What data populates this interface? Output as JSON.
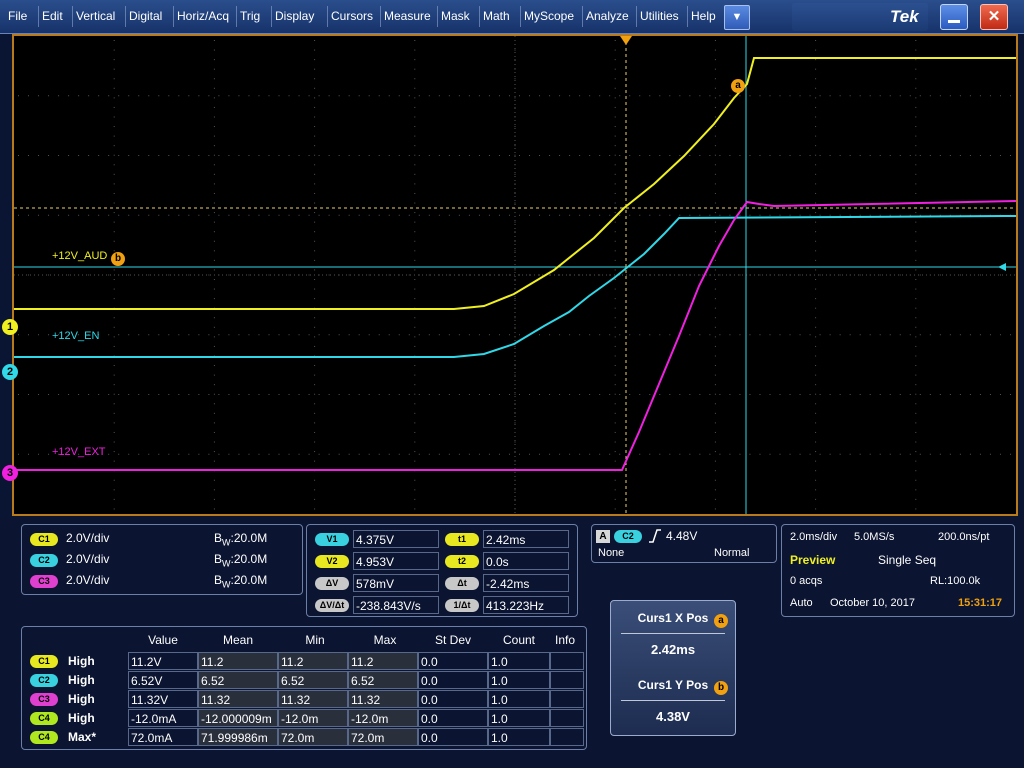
{
  "menu": {
    "items": [
      "File",
      "Edit",
      "Vertical",
      "Digital",
      "Horiz/Acq",
      "Trig",
      "Display",
      "Cursors",
      "Measure",
      "Mask",
      "Math",
      "MyScope",
      "Analyze",
      "Utilities",
      "Help"
    ],
    "dropdown_icon": "chevron-down-icon",
    "brand": "Tek"
  },
  "display": {
    "trace_labels": {
      "aud": "+12V_AUD",
      "en": "+12V_EN",
      "ext": "+12V_EXT"
    },
    "markers": {
      "ch1": "1",
      "ch2": "2",
      "ch3": "3",
      "cursor_a": "a",
      "cursor_b": "b"
    },
    "colors": {
      "ch1": "#f0f020",
      "ch2": "#30d8e8",
      "ch3": "#f020e0",
      "cursor": "#f0a010",
      "grid_border": "#b87a1a"
    }
  },
  "channels": [
    {
      "badge": "C1",
      "scale": "2.0V/div",
      "bw_prefix": "B",
      "bw_sub": "W",
      "bw_value": ":20.0M"
    },
    {
      "badge": "C2",
      "scale": "2.0V/div",
      "bw_prefix": "B",
      "bw_sub": "W",
      "bw_value": ":20.0M"
    },
    {
      "badge": "C3",
      "scale": "2.0V/div",
      "bw_prefix": "B",
      "bw_sub": "W",
      "bw_value": ":20.0M"
    }
  ],
  "cursor_readout": {
    "v1_label": "V1",
    "v1": "4.375V",
    "v2_label": "V2",
    "v2": "4.953V",
    "dv_label": "ΔV",
    "dv": "578mV",
    "dvdt_label": "ΔV/Δt",
    "dvdt": "-238.843V/s",
    "t1_label": "t1",
    "t1": "2.42ms",
    "t2_label": "t2",
    "t2": "0.0s",
    "dt_label": "Δt",
    "dt": "-2.42ms",
    "inv_dt_label": "1/Δt",
    "inv_dt": "413.223Hz"
  },
  "trigger": {
    "a_label": "A",
    "source": "C2",
    "level": "4.48V",
    "coupling": "None",
    "mode": "Normal"
  },
  "horizontal": {
    "scale": "2.0ms/div",
    "sample_rate": "5.0MS/s",
    "resolution": "200.0ns/pt",
    "state": "Preview",
    "acq_mode": "Single Seq",
    "acqs": "0 acqs",
    "record_length": "RL:100.0k",
    "run_mode": "Auto",
    "date": "October 10, 2017",
    "time": "15:31:17"
  },
  "measurements": {
    "headers": [
      "Value",
      "Mean",
      "Min",
      "Max",
      "St Dev",
      "Count",
      "Info"
    ],
    "rows": [
      {
        "badge": "C1",
        "badge_color": "yellow",
        "label": "High",
        "value": "11.2V",
        "mean": "11.2",
        "min": "11.2",
        "max": "11.2",
        "stdev": "0.0",
        "count": "1.0",
        "info": ""
      },
      {
        "badge": "C2",
        "badge_color": "cyan",
        "label": "High",
        "value": "6.52V",
        "mean": "6.52",
        "min": "6.52",
        "max": "6.52",
        "stdev": "0.0",
        "count": "1.0",
        "info": ""
      },
      {
        "badge": "C3",
        "badge_color": "magenta",
        "label": "High",
        "value": "11.32V",
        "mean": "11.32",
        "min": "11.32",
        "max": "11.32",
        "stdev": "0.0",
        "count": "1.0",
        "info": ""
      },
      {
        "badge": "C4",
        "badge_color": "green",
        "label": "High",
        "value": "-12.0mA",
        "mean": "-12.000009m",
        "min": "-12.0m",
        "max": "-12.0m",
        "stdev": "0.0",
        "count": "1.0",
        "info": ""
      },
      {
        "badge": "C4",
        "badge_color": "green",
        "label": "Max*",
        "value": "72.0mA",
        "mean": "71.999986m",
        "min": "72.0m",
        "max": "72.0m",
        "stdev": "0.0",
        "count": "1.0",
        "info": ""
      }
    ]
  },
  "cursor_pos": {
    "x_title": "Curs1 X Pos",
    "x_marker": "a",
    "x_value": "2.42ms",
    "y_title": "Curs1 Y Pos",
    "y_marker": "b",
    "y_value": "4.38V"
  }
}
